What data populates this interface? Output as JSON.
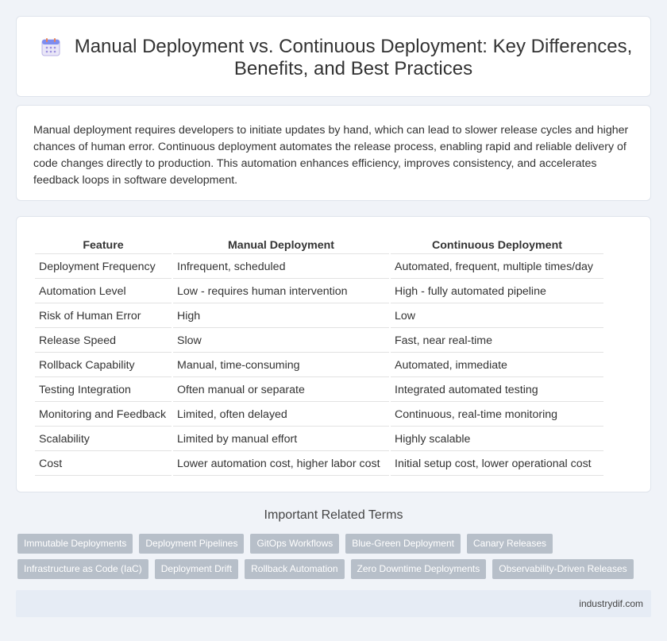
{
  "header": {
    "icon": "calendar-icon",
    "title": "Manual Deployment vs. Continuous Deployment: Key Differences, Benefits, and Best Practices"
  },
  "summary": "Manual deployment requires developers to initiate updates by hand, which can lead to slower release cycles and higher chances of human error. Continuous deployment automates the release process, enabling rapid and reliable delivery of code changes directly to production. This automation enhances efficiency, improves consistency, and accelerates feedback loops in software development.",
  "table": {
    "headers": [
      "Feature",
      "Manual Deployment",
      "Continuous Deployment"
    ],
    "rows": [
      [
        "Deployment Frequency",
        "Infrequent, scheduled",
        "Automated, frequent, multiple times/day"
      ],
      [
        "Automation Level",
        "Low - requires human intervention",
        "High - fully automated pipeline"
      ],
      [
        "Risk of Human Error",
        "High",
        "Low"
      ],
      [
        "Release Speed",
        "Slow",
        "Fast, near real-time"
      ],
      [
        "Rollback Capability",
        "Manual, time-consuming",
        "Automated, immediate"
      ],
      [
        "Testing Integration",
        "Often manual or separate",
        "Integrated automated testing"
      ],
      [
        "Monitoring and Feedback",
        "Limited, often delayed",
        "Continuous, real-time monitoring"
      ],
      [
        "Scalability",
        "Limited by manual effort",
        "Highly scalable"
      ],
      [
        "Cost",
        "Lower automation cost, higher labor cost",
        "Initial setup cost, lower operational cost"
      ]
    ]
  },
  "related": {
    "title": "Important Related Terms",
    "row1": [
      "Immutable Deployments",
      "Deployment Pipelines",
      "GitOps Workflows",
      "Blue-Green Deployment",
      "Canary Releases"
    ],
    "row2": [
      "Infrastructure as Code (IaC)",
      "Deployment Drift",
      "Rollback Automation",
      "Zero Downtime Deployments",
      "Observability-Driven Releases"
    ]
  },
  "footer": {
    "site": "industrydif.com"
  },
  "colors": {
    "background": "#f0f3f8",
    "tag": "#b7bfc9",
    "footer": "#e6ecf5"
  }
}
